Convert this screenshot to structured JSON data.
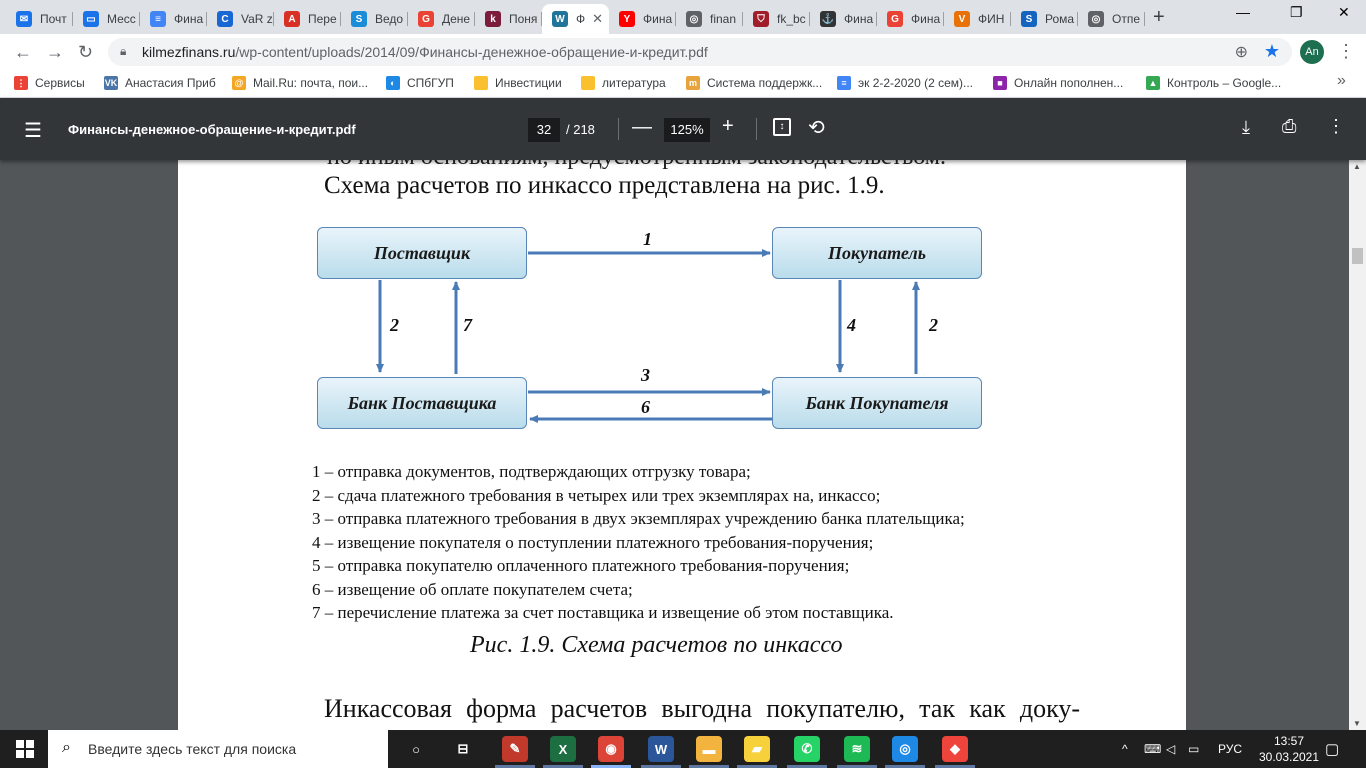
{
  "browser": {
    "tabs": [
      {
        "label": "Почт",
        "color": "#1a73e8",
        "glyph": "✉"
      },
      {
        "label": "Месс",
        "color": "#1a73e8",
        "glyph": "▭"
      },
      {
        "label": "Фина",
        "color": "#4285f4",
        "glyph": "≡"
      },
      {
        "label": "VaR z",
        "color": "#1967d2",
        "glyph": "C"
      },
      {
        "label": "Пере",
        "color": "#d93025",
        "glyph": "A"
      },
      {
        "label": "Ведо",
        "color": "#1a8cd8",
        "glyph": "S"
      },
      {
        "label": "Дене",
        "color": "#ea4335",
        "glyph": "G"
      },
      {
        "label": "Поня",
        "color": "#7b1d3a",
        "glyph": "k"
      },
      {
        "label": "Ф",
        "color": "#21759b",
        "glyph": "W"
      },
      {
        "label": "Фина",
        "color": "#ff0000",
        "glyph": "Y"
      },
      {
        "label": "finan",
        "color": "#5f6368",
        "glyph": "◎"
      },
      {
        "label": "fk_bc",
        "color": "#a01e2a",
        "glyph": "⛉"
      },
      {
        "label": "Фина",
        "color": "#333333",
        "glyph": "⚓"
      },
      {
        "label": "Фина",
        "color": "#ea4335",
        "glyph": "G"
      },
      {
        "label": "ФИН",
        "color": "#e8710a",
        "glyph": "V"
      },
      {
        "label": "Рома",
        "color": "#1565c0",
        "glyph": "S"
      },
      {
        "label": "Отпе",
        "color": "#5f6368",
        "glyph": "◎"
      }
    ],
    "new_tab": "+",
    "window_controls": [
      "—",
      "❐",
      "✕"
    ],
    "url_domain": "kilmezfinans.ru",
    "url_path": "/wp-content/uploads/2014/09/Финансы-денежное-обращение-и-кредит.pdf",
    "profile_initials": "An",
    "bookmarks": [
      {
        "label": "Сервисы",
        "color": "#ea4335",
        "glyph": "⋮"
      },
      {
        "label": "Анастасия Приб",
        "color": "#4a76a8",
        "glyph": "VK"
      },
      {
        "label": "Mail.Ru: почта, пои...",
        "color": "#f5a623",
        "glyph": "@"
      },
      {
        "label": "СПбГУП",
        "color": "#1e88e5",
        "glyph": "◐"
      },
      {
        "label": "Инвестиции",
        "color": "#fbc02d",
        "glyph": ""
      },
      {
        "label": "литература",
        "color": "#fbc02d",
        "glyph": ""
      },
      {
        "label": "Система поддержк...",
        "color": "#e8a33c",
        "glyph": "m"
      },
      {
        "label": "эк 2-2-2020 (2 сем)...",
        "color": "#4285f4",
        "glyph": "≡"
      },
      {
        "label": "Онлайн пополнен...",
        "color": "#8e24aa",
        "glyph": "■"
      },
      {
        "label": "Контроль – Google...",
        "color": "#34a853",
        "glyph": "▲"
      }
    ],
    "bookmarks_more": "»"
  },
  "pdf_viewer": {
    "title": "Финансы-денежное-обращение-и-кредит.pdf",
    "current_page": "32",
    "total_pages": "/ 218",
    "zoom": "125%"
  },
  "document": {
    "cut_line": "по иным основаниям, предусмотренным законодательством.",
    "intro": "Схема расчетов по инкассо представлена на рис. 1.9.",
    "diagram": {
      "supplier": "Поставщик",
      "buyer": "Покупатель",
      "supplier_bank": "Банк Поставщика",
      "buyer_bank": "Банк Покупателя",
      "labels": [
        "1",
        "2",
        "7",
        "4",
        "2",
        "3",
        "6"
      ]
    },
    "legend": [
      "1 – отправка документов, подтверждающих отгрузку товара;",
      "2 – сдача платежного требования в четырех или трех экземплярах на, инкассо;",
      "3 – отправка платежного требования в двух экземплярах учреждению банка плательщика;",
      "4 – извещение покупателя о поступлении платежного требования-поручения;",
      "5 – отправка покупателю оплаченного платежного требования-поручения;",
      "6 – извещение об оплате покупателем счета;",
      "7 – перечисление платежа за счет поставщика и извещение об этом поставщика."
    ],
    "caption": "Рис. 1.9. Схема расчетов по инкассо",
    "body_start": "Инкассовая форма расчетов выгодна покупателю, так как доку-"
  },
  "taskbar": {
    "search_placeholder": "Введите здесь текст для поиска",
    "apps": [
      {
        "name": "task-view",
        "color": "#1f1f1f",
        "glyph": "○"
      },
      {
        "name": "widgets",
        "color": "#1f1f1f",
        "glyph": "⊟"
      },
      {
        "name": "app-red",
        "color": "#c0392b",
        "glyph": "✎"
      },
      {
        "name": "excel",
        "color": "#1d6f42",
        "glyph": "X"
      },
      {
        "name": "chrome",
        "color": "#db4437",
        "glyph": "◉"
      },
      {
        "name": "word",
        "color": "#2b579a",
        "glyph": "W"
      },
      {
        "name": "explorer",
        "color": "#f3b43f",
        "glyph": "▬"
      },
      {
        "name": "sticky",
        "color": "#f7d13c",
        "glyph": "▰"
      },
      {
        "name": "whatsapp",
        "color": "#25d366",
        "glyph": "✆"
      },
      {
        "name": "spotify",
        "color": "#1db954",
        "glyph": "≋"
      },
      {
        "name": "instagram",
        "color": "#1e88e5",
        "glyph": "◎"
      },
      {
        "name": "anydesk",
        "color": "#ef443b",
        "glyph": "◆"
      }
    ],
    "tray_icons": [
      "^",
      "⌨",
      "◁",
      "▭"
    ],
    "language": "РУС",
    "time": "13:57",
    "date": "30.03.2021"
  }
}
